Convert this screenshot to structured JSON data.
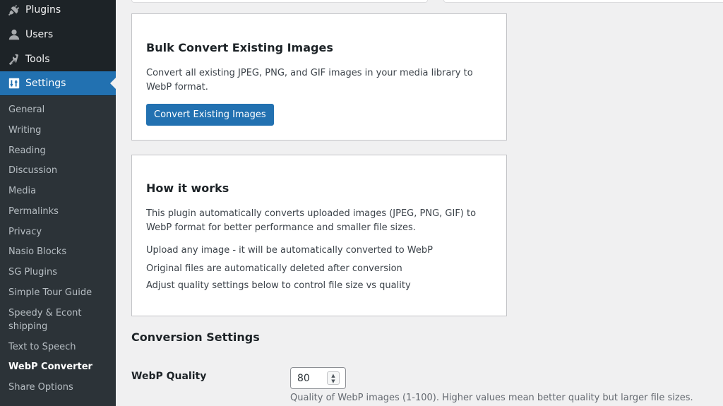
{
  "sidebar": {
    "menu": [
      {
        "label": "Plugins",
        "icon": "plugin-icon"
      },
      {
        "label": "Users",
        "icon": "users-icon"
      },
      {
        "label": "Tools",
        "icon": "wrench-icon"
      },
      {
        "label": "Settings",
        "icon": "settings-icon",
        "active": true
      }
    ],
    "submenu": [
      "General",
      "Writing",
      "Reading",
      "Discussion",
      "Media",
      "Permalinks",
      "Privacy",
      "Nasio Blocks",
      "SG Plugins",
      "Simple Tour Guide",
      "Speedy & Econt shipping",
      "Text to Speech",
      "WebP Converter",
      "Share Options"
    ],
    "current": "WebP Converter"
  },
  "bulk": {
    "title": "Bulk Convert Existing Images",
    "description": "Convert all existing JPEG, PNG, and GIF images in your media library to WebP format.",
    "button": "Convert Existing Images"
  },
  "how": {
    "title": "How it works",
    "description": "This plugin automatically converts uploaded images (JPEG, PNG, GIF) to WebP format for better performance and smaller file sizes.",
    "points": [
      "Upload any image - it will be automatically converted to WebP",
      "Original files are automatically deleted after conversion",
      "Adjust quality settings below to control file size vs quality"
    ]
  },
  "settings": {
    "title": "Conversion Settings",
    "quality_label": "WebP Quality",
    "quality_value": "80",
    "quality_desc": "Quality of WebP images (1-100). Higher values mean better quality but larger file sizes."
  },
  "colors": {
    "sidebar_bg": "#1d2327",
    "submenu_bg": "#2c3338",
    "accent": "#2271b1"
  }
}
